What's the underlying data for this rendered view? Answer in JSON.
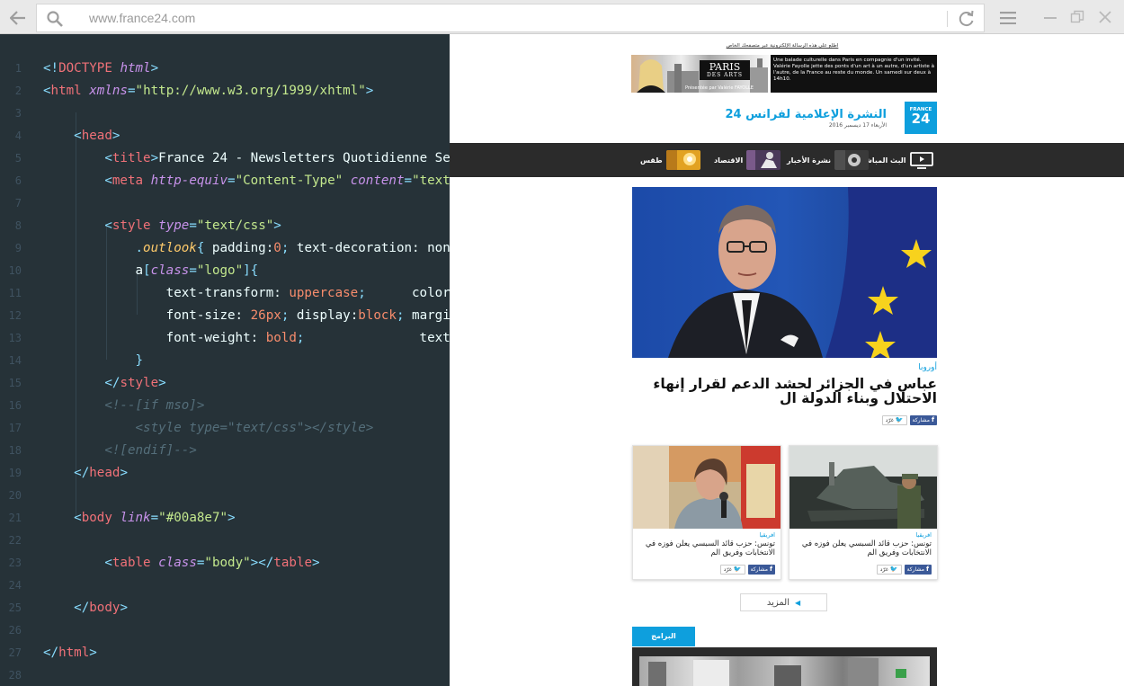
{
  "browser": {
    "url": "www.france24.com"
  },
  "editor": {
    "line_numbers": [
      "1",
      "2",
      "3",
      "4",
      "5",
      "6",
      "7",
      "8",
      "9",
      "10",
      "11",
      "12",
      "13",
      "14",
      "15",
      "16",
      "17",
      "18",
      "19",
      "20",
      "21",
      "22",
      "23",
      "24",
      "25",
      "26",
      "27",
      "28"
    ],
    "lines": [
      [
        [
          "p",
          "<!"
        ],
        [
          "t",
          "DOCTYPE"
        ],
        [
          "x",
          " "
        ],
        [
          "a",
          "html"
        ],
        [
          "p",
          ">"
        ]
      ],
      [
        [
          "p",
          "<"
        ],
        [
          "t",
          "html"
        ],
        [
          "x",
          " "
        ],
        [
          "a",
          "xmlns"
        ],
        [
          "p",
          "="
        ],
        [
          "s",
          "\"http://www.w3.org/1999/xhtml\""
        ],
        [
          "p",
          ">"
        ]
      ],
      [],
      [
        [
          "x",
          "    "
        ],
        [
          "p",
          "<"
        ],
        [
          "t",
          "head"
        ],
        [
          "p",
          ">"
        ]
      ],
      [
        [
          "x",
          "        "
        ],
        [
          "p",
          "<"
        ],
        [
          "t",
          "title"
        ],
        [
          "p",
          ">"
        ],
        [
          "x",
          "France 24 - Newsletters Quotidienne Se"
        ]
      ],
      [
        [
          "x",
          "        "
        ],
        [
          "p",
          "<"
        ],
        [
          "t",
          "meta"
        ],
        [
          "x",
          " "
        ],
        [
          "a",
          "http-equiv"
        ],
        [
          "p",
          "="
        ],
        [
          "s",
          "\"Content-Type\""
        ],
        [
          "x",
          " "
        ],
        [
          "a",
          "content"
        ],
        [
          "p",
          "="
        ],
        [
          "s",
          "\"text"
        ]
      ],
      [],
      [
        [
          "x",
          "        "
        ],
        [
          "p",
          "<"
        ],
        [
          "t",
          "style"
        ],
        [
          "x",
          " "
        ],
        [
          "a",
          "type"
        ],
        [
          "p",
          "="
        ],
        [
          "s",
          "\"text/css\""
        ],
        [
          "p",
          ">"
        ]
      ],
      [
        [
          "x",
          "            "
        ],
        [
          "p",
          "."
        ],
        [
          "c",
          "outlook"
        ],
        [
          "p",
          "{"
        ],
        [
          "x",
          " padding:"
        ],
        [
          "n",
          "0"
        ],
        [
          "p",
          ";"
        ],
        [
          "x",
          " text-decoration: non"
        ]
      ],
      [
        [
          "x",
          "            "
        ],
        [
          "x",
          "a"
        ],
        [
          "p",
          "["
        ],
        [
          "a",
          "class"
        ],
        [
          "p",
          "="
        ],
        [
          "s",
          "\"logo\""
        ],
        [
          "p",
          "]{"
        ]
      ],
      [
        [
          "x",
          "                "
        ],
        [
          "x",
          "text-transform: "
        ],
        [
          "n",
          "uppercase"
        ],
        [
          "p",
          ";"
        ],
        [
          "x",
          "      color"
        ]
      ],
      [
        [
          "x",
          "                "
        ],
        [
          "x",
          "font-size: "
        ],
        [
          "n",
          "26px"
        ],
        [
          "p",
          ";"
        ],
        [
          "x",
          " display:"
        ],
        [
          "n",
          "block"
        ],
        [
          "p",
          ";"
        ],
        [
          "x",
          " margi"
        ]
      ],
      [
        [
          "x",
          "                "
        ],
        [
          "x",
          "font-weight: "
        ],
        [
          "n",
          "bold"
        ],
        [
          "p",
          ";"
        ],
        [
          "x",
          "               text-"
        ]
      ],
      [
        [
          "x",
          "            "
        ],
        [
          "p",
          "}"
        ]
      ],
      [
        [
          "x",
          "        "
        ],
        [
          "p",
          "</"
        ],
        [
          "t",
          "style"
        ],
        [
          "p",
          ">"
        ]
      ],
      [
        [
          "x",
          "        "
        ],
        [
          "m",
          "<!--[if mso]>"
        ]
      ],
      [
        [
          "x",
          "            "
        ],
        [
          "m",
          "<style type=\"text/css\"></style>"
        ]
      ],
      [
        [
          "x",
          "        "
        ],
        [
          "m",
          "<![endif]-->"
        ]
      ],
      [
        [
          "x",
          "    "
        ],
        [
          "p",
          "</"
        ],
        [
          "t",
          "head"
        ],
        [
          "p",
          ">"
        ]
      ],
      [],
      [
        [
          "x",
          "    "
        ],
        [
          "p",
          "<"
        ],
        [
          "t",
          "body"
        ],
        [
          "x",
          " "
        ],
        [
          "a",
          "link"
        ],
        [
          "p",
          "="
        ],
        [
          "s",
          "\"#00a8e7\""
        ],
        [
          "p",
          ">"
        ]
      ],
      [],
      [
        [
          "x",
          "        "
        ],
        [
          "p",
          "<"
        ],
        [
          "t",
          "table"
        ],
        [
          "x",
          " "
        ],
        [
          "a",
          "class"
        ],
        [
          "p",
          "="
        ],
        [
          "s",
          "\"body\""
        ],
        [
          "p",
          "></"
        ],
        [
          "t",
          "table"
        ],
        [
          "p",
          ">"
        ]
      ],
      [],
      [
        [
          "x",
          "    "
        ],
        [
          "p",
          "</"
        ],
        [
          "t",
          "body"
        ],
        [
          "p",
          ">"
        ]
      ],
      [],
      [
        [
          "p",
          "</"
        ],
        [
          "t",
          "html"
        ],
        [
          "p",
          ">"
        ]
      ],
      []
    ]
  },
  "newsletter": {
    "preheader": "اطلع على هذه الرسالة الإلكترونية عبر متصفحك الخاص",
    "ad": {
      "brand_line1": "PARIS",
      "brand_line2": "DES ARTS",
      "credit": "Présentée par Valérie FAYOLLE",
      "blurb": "Une balade culturelle dans Paris en compagnie d'un invité. Valérie Fayolle jette des ponts d'un art à un autre, d'un artiste à l'autre, de la France au reste du monde. Un samedi sur deux à 14h10."
    },
    "logo_text_top": "FRANCE",
    "logo_text_num": "24",
    "title": "النشرة الإعلامية لفرانس 24",
    "date": "الأربعاء 17 ديسمبر 2016",
    "nav": [
      {
        "label": "البث المباشر",
        "icon": "tv-icon"
      },
      {
        "label": "نشرة الأخبار",
        "icon": "news-thumb"
      },
      {
        "label": "الاقتصاد",
        "icon": "economy-thumb"
      },
      {
        "label": "طقس",
        "icon": "weather-thumb"
      }
    ],
    "main_article": {
      "category": "أوروبا",
      "headline": "عباس في الجزائر لحشد الدعم لقرار إنهاء الاحتلال وبناء الدولة ال"
    },
    "share": {
      "facebook": "مشاركة",
      "twitter": "غرّد"
    },
    "cards": [
      {
        "category": "افريقيا",
        "headline": "تونس: حزب قائد السبسي يعلن فوزه في الانتخابات وفريق الم"
      },
      {
        "category": "افريقيا",
        "headline": "تونس: حزب قائد السبسي يعلن فوزه في الانتخابات وفريق الم"
      }
    ],
    "more_label": "المزيد",
    "programs_label": "البرامج"
  }
}
